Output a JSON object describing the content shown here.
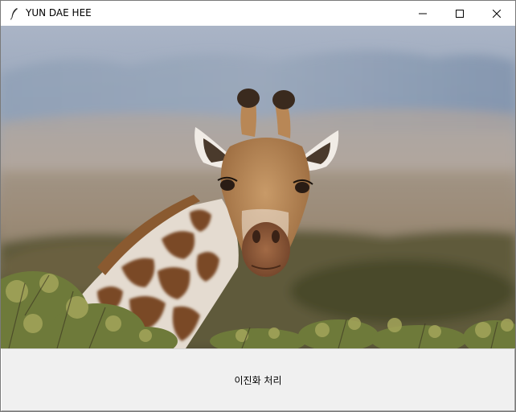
{
  "window": {
    "title": "YUN DAE HEE",
    "app_icon": "feather-icon",
    "controls": [
      "minimize-icon",
      "maximize-icon",
      "close-icon"
    ]
  },
  "image": {
    "subject": "giraffe-photo"
  },
  "action_button": {
    "label": "이진화 처리"
  }
}
